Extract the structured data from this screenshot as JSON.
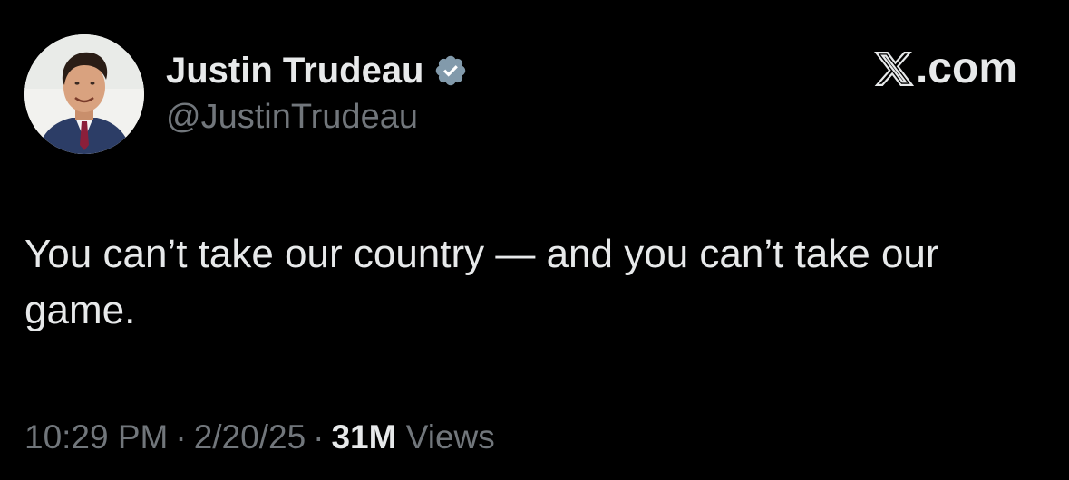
{
  "tweet": {
    "author": {
      "display_name": "Justin Trudeau",
      "handle": "@JustinTrudeau",
      "verified_icon": "verified-badge-icon",
      "avatar": "profile-photo"
    },
    "brand": {
      "label": ".com",
      "icon": "x-logo-icon"
    },
    "text": "You can’t take our country — and you can’t take our game.",
    "meta": {
      "time": "10:29 PM",
      "separator": "·",
      "date": "2/20/25",
      "views_count": "31M",
      "views_label": "Views"
    }
  },
  "colors": {
    "background": "#000000",
    "primary_text": "#e7e9ea",
    "secondary_text": "#71767b",
    "verified_badge": "#829aab"
  }
}
